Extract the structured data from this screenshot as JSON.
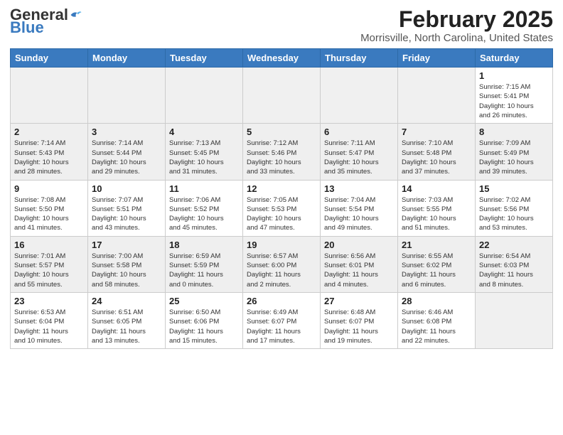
{
  "header": {
    "logo_general": "General",
    "logo_blue": "Blue",
    "title": "February 2025",
    "subtitle": "Morrisville, North Carolina, United States"
  },
  "weekdays": [
    "Sunday",
    "Monday",
    "Tuesday",
    "Wednesday",
    "Thursday",
    "Friday",
    "Saturday"
  ],
  "weeks": [
    [
      {
        "day": "",
        "info": ""
      },
      {
        "day": "",
        "info": ""
      },
      {
        "day": "",
        "info": ""
      },
      {
        "day": "",
        "info": ""
      },
      {
        "day": "",
        "info": ""
      },
      {
        "day": "",
        "info": ""
      },
      {
        "day": "1",
        "info": "Sunrise: 7:15 AM\nSunset: 5:41 PM\nDaylight: 10 hours\nand 26 minutes."
      }
    ],
    [
      {
        "day": "2",
        "info": "Sunrise: 7:14 AM\nSunset: 5:43 PM\nDaylight: 10 hours\nand 28 minutes."
      },
      {
        "day": "3",
        "info": "Sunrise: 7:14 AM\nSunset: 5:44 PM\nDaylight: 10 hours\nand 29 minutes."
      },
      {
        "day": "4",
        "info": "Sunrise: 7:13 AM\nSunset: 5:45 PM\nDaylight: 10 hours\nand 31 minutes."
      },
      {
        "day": "5",
        "info": "Sunrise: 7:12 AM\nSunset: 5:46 PM\nDaylight: 10 hours\nand 33 minutes."
      },
      {
        "day": "6",
        "info": "Sunrise: 7:11 AM\nSunset: 5:47 PM\nDaylight: 10 hours\nand 35 minutes."
      },
      {
        "day": "7",
        "info": "Sunrise: 7:10 AM\nSunset: 5:48 PM\nDaylight: 10 hours\nand 37 minutes."
      },
      {
        "day": "8",
        "info": "Sunrise: 7:09 AM\nSunset: 5:49 PM\nDaylight: 10 hours\nand 39 minutes."
      }
    ],
    [
      {
        "day": "9",
        "info": "Sunrise: 7:08 AM\nSunset: 5:50 PM\nDaylight: 10 hours\nand 41 minutes."
      },
      {
        "day": "10",
        "info": "Sunrise: 7:07 AM\nSunset: 5:51 PM\nDaylight: 10 hours\nand 43 minutes."
      },
      {
        "day": "11",
        "info": "Sunrise: 7:06 AM\nSunset: 5:52 PM\nDaylight: 10 hours\nand 45 minutes."
      },
      {
        "day": "12",
        "info": "Sunrise: 7:05 AM\nSunset: 5:53 PM\nDaylight: 10 hours\nand 47 minutes."
      },
      {
        "day": "13",
        "info": "Sunrise: 7:04 AM\nSunset: 5:54 PM\nDaylight: 10 hours\nand 49 minutes."
      },
      {
        "day": "14",
        "info": "Sunrise: 7:03 AM\nSunset: 5:55 PM\nDaylight: 10 hours\nand 51 minutes."
      },
      {
        "day": "15",
        "info": "Sunrise: 7:02 AM\nSunset: 5:56 PM\nDaylight: 10 hours\nand 53 minutes."
      }
    ],
    [
      {
        "day": "16",
        "info": "Sunrise: 7:01 AM\nSunset: 5:57 PM\nDaylight: 10 hours\nand 55 minutes."
      },
      {
        "day": "17",
        "info": "Sunrise: 7:00 AM\nSunset: 5:58 PM\nDaylight: 10 hours\nand 58 minutes."
      },
      {
        "day": "18",
        "info": "Sunrise: 6:59 AM\nSunset: 5:59 PM\nDaylight: 11 hours\nand 0 minutes."
      },
      {
        "day": "19",
        "info": "Sunrise: 6:57 AM\nSunset: 6:00 PM\nDaylight: 11 hours\nand 2 minutes."
      },
      {
        "day": "20",
        "info": "Sunrise: 6:56 AM\nSunset: 6:01 PM\nDaylight: 11 hours\nand 4 minutes."
      },
      {
        "day": "21",
        "info": "Sunrise: 6:55 AM\nSunset: 6:02 PM\nDaylight: 11 hours\nand 6 minutes."
      },
      {
        "day": "22",
        "info": "Sunrise: 6:54 AM\nSunset: 6:03 PM\nDaylight: 11 hours\nand 8 minutes."
      }
    ],
    [
      {
        "day": "23",
        "info": "Sunrise: 6:53 AM\nSunset: 6:04 PM\nDaylight: 11 hours\nand 10 minutes."
      },
      {
        "day": "24",
        "info": "Sunrise: 6:51 AM\nSunset: 6:05 PM\nDaylight: 11 hours\nand 13 minutes."
      },
      {
        "day": "25",
        "info": "Sunrise: 6:50 AM\nSunset: 6:06 PM\nDaylight: 11 hours\nand 15 minutes."
      },
      {
        "day": "26",
        "info": "Sunrise: 6:49 AM\nSunset: 6:07 PM\nDaylight: 11 hours\nand 17 minutes."
      },
      {
        "day": "27",
        "info": "Sunrise: 6:48 AM\nSunset: 6:07 PM\nDaylight: 11 hours\nand 19 minutes."
      },
      {
        "day": "28",
        "info": "Sunrise: 6:46 AM\nSunset: 6:08 PM\nDaylight: 11 hours\nand 22 minutes."
      },
      {
        "day": "",
        "info": ""
      }
    ]
  ]
}
